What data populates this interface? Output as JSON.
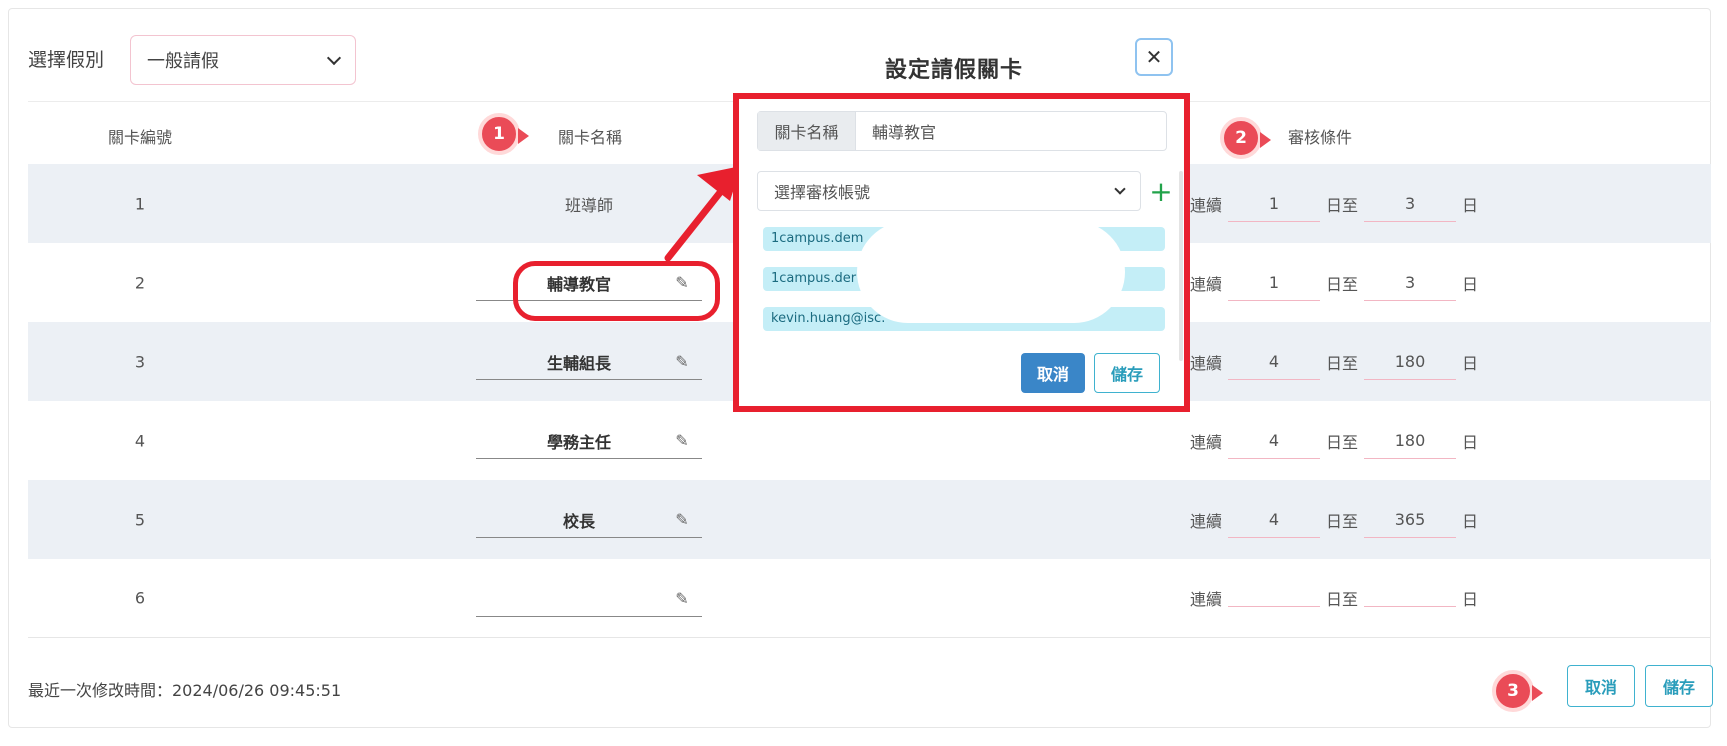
{
  "page": {
    "leave_type_label": "選擇假別",
    "leave_type_value": "一般請假",
    "modal_title": "設定請假關卡",
    "close_glyph": "✕"
  },
  "table": {
    "headers": {
      "num": "關卡編號",
      "name": "關卡名稱",
      "cond": "審核條件"
    },
    "rows": [
      {
        "num": "1",
        "name": "班導師",
        "editable": false,
        "from": "1",
        "to": "3"
      },
      {
        "num": "2",
        "name": "輔導教官",
        "editable": true,
        "from": "1",
        "to": "3"
      },
      {
        "num": "3",
        "name": "生輔組長",
        "editable": true,
        "from": "4",
        "to": "180"
      },
      {
        "num": "4",
        "name": "學務主任",
        "editable": true,
        "from": "4",
        "to": "180"
      },
      {
        "num": "5",
        "name": "校長",
        "editable": true,
        "from": "4",
        "to": "365"
      },
      {
        "num": "6",
        "name": "",
        "editable": true,
        "from": "",
        "to": ""
      }
    ],
    "cond_labels": {
      "prefix": "連續",
      "mid": "日至",
      "suffix": "日"
    }
  },
  "modal": {
    "name_addon": "關卡名稱",
    "name_value": "輔導教官",
    "account_placeholder": "選擇審核帳號",
    "add_glyph": "+",
    "accounts": [
      "1campus.dem",
      "1campus.der",
      "kevin.huang@isc."
    ],
    "cancel": "取消",
    "save": "儲存"
  },
  "badges": [
    "1",
    "2",
    "3"
  ],
  "footer": {
    "last_modified": "最近一次修改時間：2024/06/26 09:45:51",
    "cancel": "取消",
    "save": "儲存"
  },
  "colors": {
    "accent": "#3a86c8",
    "highlight": "#e8202e",
    "badge": "#ea4b57",
    "row_alt": "#ecf0f5"
  }
}
